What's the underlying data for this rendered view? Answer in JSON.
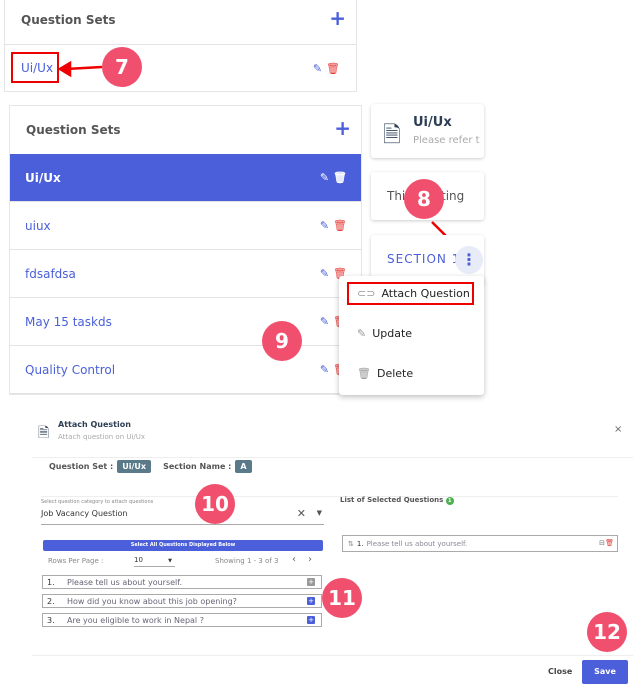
{
  "top_panel": {
    "title": "Question Sets",
    "item": "Ui/Ux"
  },
  "sets_panel": {
    "title": "Question Sets",
    "items": [
      {
        "label": "Ui/Ux",
        "selected": true
      },
      {
        "label": "uiux"
      },
      {
        "label": "fdsafdsa"
      },
      {
        "label": "May 15 taskds"
      },
      {
        "label": "Quality Control"
      }
    ]
  },
  "cards": {
    "title": "Ui/Ux",
    "subtitle": "Please refer t",
    "text": "This",
    "text_end": "ting",
    "section": "SECTION 1"
  },
  "menu": {
    "items": [
      "Attach Question",
      "Update",
      "Delete"
    ]
  },
  "badges": [
    "7",
    "8",
    "9",
    "10",
    "11",
    "12"
  ],
  "dialog": {
    "title": "Attach Question",
    "subtitle": "Attach question on Ui/Ux",
    "close": "×",
    "question_set_label": "Question Set :",
    "question_set_value": "Ui/Ux",
    "section_label": "Section Name :",
    "section_value": "A",
    "category_label": "Select question category to attach questions",
    "category_value": "Job Vacancy Question",
    "select_all": "Select All Questions Displayed Below",
    "rows_label": "Rows Per Page :",
    "rows_value": "10",
    "showing": "Showing 1 - 3 of 3",
    "questions": [
      {
        "n": "1.",
        "text": "Please tell us about yourself.",
        "added": true
      },
      {
        "n": "2.",
        "text": "How did you know about this job opening?"
      },
      {
        "n": "3.",
        "text": "Are you eligible to work in Nepal ?"
      }
    ],
    "selected_title": "List of Selected Questions",
    "selected_count": "1",
    "selected": [
      {
        "n": "1.",
        "text": "Please tell us about yourself."
      }
    ],
    "close_btn": "Close",
    "save_btn": "Save"
  },
  "colors": {
    "accent": "#4a5fd9",
    "badge": "#f0506e",
    "highlight": "#e00000"
  }
}
